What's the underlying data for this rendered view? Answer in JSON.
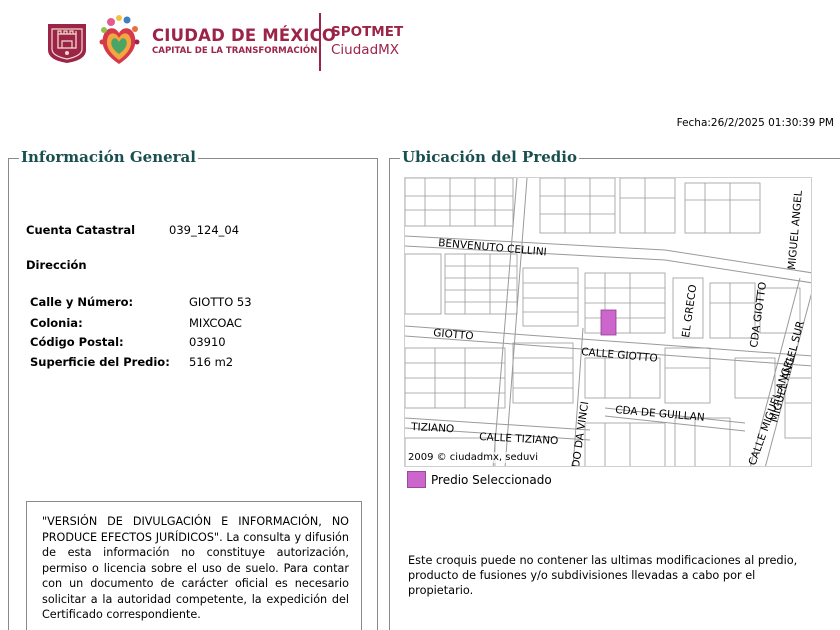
{
  "header": {
    "brand_title": "CIUDAD DE MÉXICO",
    "brand_subtitle": "CAPITAL DE LA TRANSFORMACIÓN",
    "app_title": "SPOTMET",
    "app_subtitle": "CiudadMX",
    "brand_color": "#9d2449"
  },
  "fecha": "Fecha:26/2/2025 01:30:39 PM",
  "info_general": {
    "title": "Información General",
    "cuenta_label": "Cuenta Catastral",
    "cuenta_value": "039_124_04",
    "direccion_label": "Dirección",
    "calle_label": "Calle y Número:",
    "calle_value": "GIOTTO 53",
    "colonia_label": "Colonia:",
    "colonia_value": "MIXCOAC",
    "cp_label": "Código Postal:",
    "cp_value": "03910",
    "superficie_label": "Superficie del Predio:",
    "superficie_value": "516 m2",
    "disclaimer": "\"VERSIÓN DE DIVULGACIÓN E INFORMACIÓN, NO PRODUCE EFECTOS JURÍDICOS\". La consulta y difusión de esta información no constituye autorización, permiso o licencia sobre el uso de suelo. Para contar con un documento de carácter oficial es necesario solicitar a la autoridad competente, la expedición del Certificado correspondiente."
  },
  "ubicacion": {
    "title": "Ubicación del Predio",
    "map_credit": "2009 © ciudadmx, seduvi",
    "legend_label": "Predio Seleccionado",
    "highlight_color": "#cc66cc",
    "streets": {
      "benvenuto": "BENVENUTO CELLINI",
      "miguel_angel": "MIGUEL ANGEL",
      "giotto_left": "GIOTTO",
      "calle_giotto": "CALLE GIOTTO",
      "el_greco": "EL GRECO",
      "cda_giotto": "CDA GIOTTO",
      "miguel_angel_sur": "MIGUEL ANGEL SUR",
      "cda_guillan": "CDA DE GUILLAN",
      "tiziano": "TIZIANO",
      "calle_tiziano": "CALLE TIZIANO",
      "da_vinci": "DO DA VINCI",
      "calle_miguel_angel": "CALLE MIGUEL ANGEL"
    },
    "note": "Este croquis puede no contener las ultimas modificaciones al predio, producto de fusiones y/o subdivisiones llevadas a cabo por el propietario."
  }
}
